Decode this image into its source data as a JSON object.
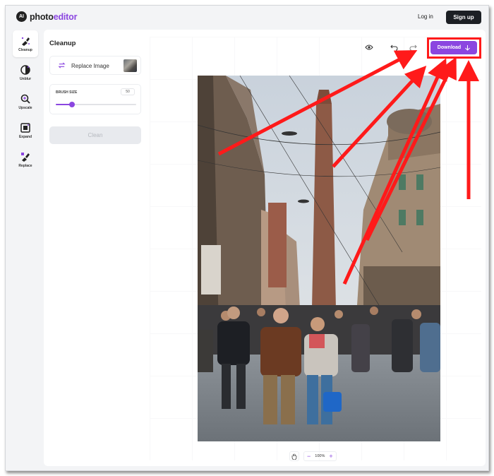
{
  "header": {
    "logo_badge": "AI",
    "logo_primary": "photo",
    "logo_accent": "editor",
    "login_label": "Log in",
    "signup_label": "Sign up"
  },
  "sidebar": {
    "items": [
      {
        "label": "Cleanup",
        "icon": "cleanup-icon",
        "active": true
      },
      {
        "label": "Unblur",
        "icon": "unblur-icon",
        "active": false
      },
      {
        "label": "Upscale",
        "icon": "upscale-icon",
        "active": false
      },
      {
        "label": "Expand",
        "icon": "expand-icon",
        "active": false
      },
      {
        "label": "Replace",
        "icon": "replace-icon",
        "active": false
      }
    ]
  },
  "panel": {
    "title": "Cleanup",
    "replace_label": "Replace Image",
    "brush_label": "BRUSH SIZE",
    "brush_value": "50",
    "brush_fraction": 0.2,
    "clean_label": "Clean"
  },
  "toolbar": {
    "download_label": "Download",
    "download_icon": "arrow-down-icon",
    "eye_icon": "eye-icon",
    "undo_icon": "undo-icon",
    "redo_icon": "redo-icon"
  },
  "zoom": {
    "value": "100%",
    "minus": "−",
    "plus": "+"
  },
  "colors": {
    "accent": "#8b46e0",
    "annotation": "#ff1a1a",
    "dark_button": "#1c1f24"
  }
}
